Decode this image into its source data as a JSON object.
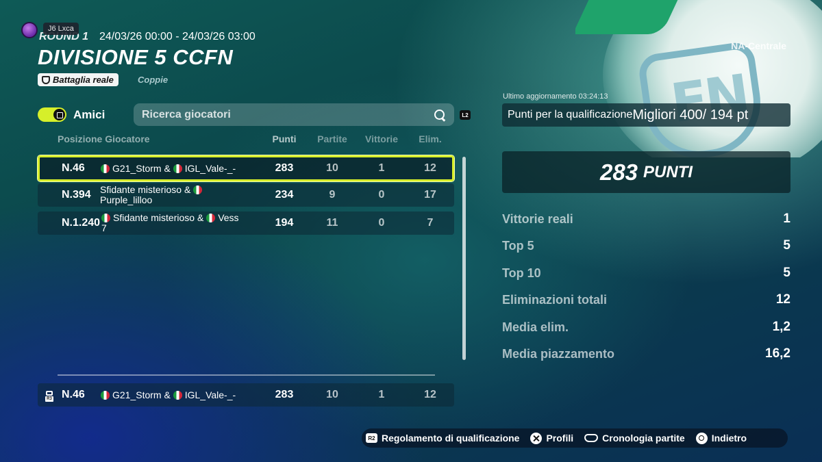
{
  "header": {
    "username": "J6 Lxca",
    "round_label": "ROUND 1",
    "date_range": "24/03/26 00:00 - 24/03/26 03:00",
    "title": "DIVISIONE 5 CCFN",
    "mode": "Battaglia reale",
    "team_mode": "Coppie",
    "region": "NA-Centrale"
  },
  "controls": {
    "friends_label": "Amici",
    "search_placeholder": "Ricerca giocatori",
    "l2_tag": "L2"
  },
  "table": {
    "columns": {
      "position_player": "Posizione Giocatore",
      "points": "Punti",
      "matches": "Partite",
      "wins": "Vittorie",
      "elims": "Elim."
    },
    "rows": [
      {
        "pos": "N.46",
        "p1": "G21_Storm &",
        "p2": "IGL_Vale-_-",
        "points": "283",
        "matches": "10",
        "wins": "1",
        "elims": "12"
      },
      {
        "pos": "N.394",
        "p1": "Sfidante misterioso &",
        "p2": "Purple_lilloo",
        "points": "234",
        "matches": "9",
        "wins": "0",
        "elims": "17"
      },
      {
        "pos": "N.1.240",
        "p1": "Sfidante misterioso &",
        "p2": "Vess",
        "p3": "7",
        "points": "194",
        "matches": "11",
        "wins": "0",
        "elims": "7"
      }
    ],
    "self_row": {
      "tag": "R3",
      "pos": "N.46",
      "p1": "G21_Storm &",
      "p2": "IGL_Vale-_-",
      "points": "283",
      "matches": "10",
      "wins": "1",
      "elims": "12"
    }
  },
  "panel": {
    "last_update": "Ultimo aggiornamento 03:24:13",
    "qual_label": "Punti per la qualificazione",
    "qual_value": "Migliori 400/ 194 pt",
    "score_value": "283",
    "score_unit": "PUNTI",
    "stats": [
      {
        "label": "Vittorie reali",
        "value": "1"
      },
      {
        "label": "Top 5",
        "value": "5"
      },
      {
        "label": "Top 10",
        "value": "5"
      },
      {
        "label": "Eliminazioni totali",
        "value": "12"
      },
      {
        "label": "Media elim.",
        "value": "1,2"
      },
      {
        "label": "Media piazzamento",
        "value": "16,2"
      }
    ]
  },
  "footer": {
    "r2_tag": "R2",
    "rules": "Regolamento di qualificazione",
    "profiles": "Profili",
    "history": "Cronologia partite",
    "back": "Indietro"
  },
  "colors": {
    "accent": "#d8ef2a",
    "italy_green": "#1a9a3c",
    "italy_red": "#d6283a"
  },
  "icons": [
    "avatar",
    "shield-icon",
    "friends-toggle",
    "search-icon",
    "flag-italy-icon",
    "r3-player-icon",
    "r2-button-icon",
    "cross-button-icon",
    "gamepad-icon",
    "circle-button-icon"
  ]
}
